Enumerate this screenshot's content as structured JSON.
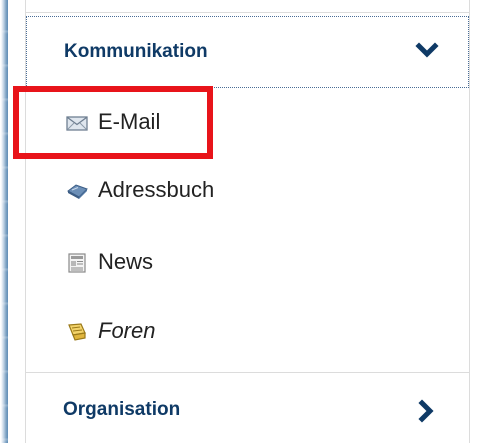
{
  "sections": [
    {
      "title": "Kommunikation",
      "expanded": true,
      "chevron_icon": "chevron-down-icon",
      "items": [
        {
          "label": "E-Mail",
          "icon": "envelope-icon",
          "italic": false,
          "highlighted": true
        },
        {
          "label": "Adressbuch",
          "icon": "address-book-icon",
          "italic": false,
          "highlighted": false
        },
        {
          "label": "News",
          "icon": "newspaper-icon",
          "italic": false,
          "highlighted": false
        },
        {
          "label": "Foren",
          "icon": "forum-icon",
          "italic": true,
          "highlighted": false
        }
      ]
    },
    {
      "title": "Organisation",
      "expanded": false,
      "chevron_icon": "chevron-right-icon",
      "items": []
    }
  ],
  "colors": {
    "section_title": "#0f3a66",
    "item_text": "#222222",
    "highlight_border": "#e8141a",
    "focus_outline": "#4a6d96"
  }
}
